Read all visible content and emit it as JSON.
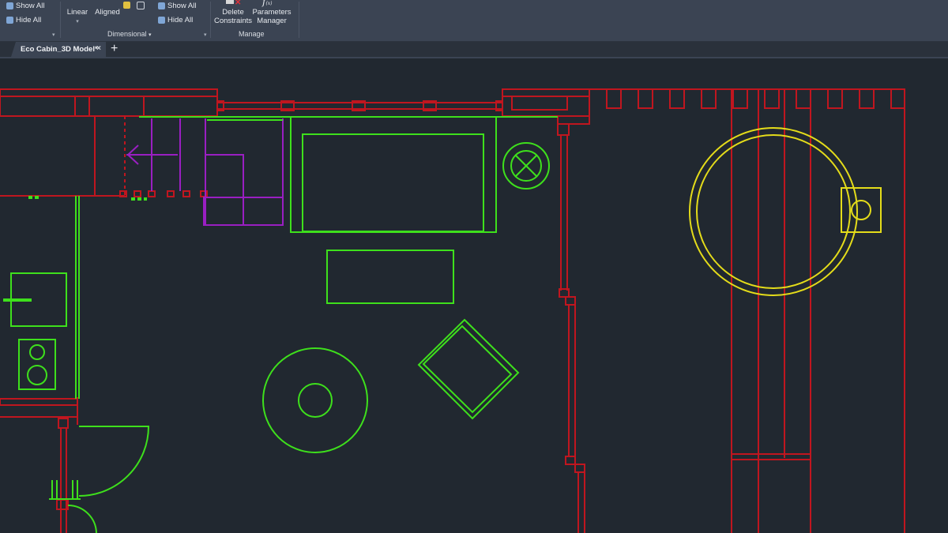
{
  "ribbon": {
    "show_all_1": "Show All",
    "hide_all_1": "Hide All",
    "linear": "Linear",
    "aligned": "Aligned",
    "show_all_2": "Show All",
    "hide_all_2": "Hide All",
    "delete_constraints_line1": "Delete",
    "delete_constraints_line2": "Constraints",
    "parameters_manager_line1": "Parameters",
    "parameters_manager_line2": "Manager",
    "group_dimensional": "Dimensional",
    "group_manage": "Manage"
  },
  "tabs": [
    {
      "label": "Eco Cabin_3D Model*",
      "close": "×"
    }
  ],
  "new_tab": "+",
  "colors": {
    "background": "#212830",
    "ribbon": "#3b4453",
    "walls": "#c0161f",
    "furniture": "#3ee01c",
    "stairs": "#9a1fc2",
    "fixture": "#e4dc1a"
  }
}
